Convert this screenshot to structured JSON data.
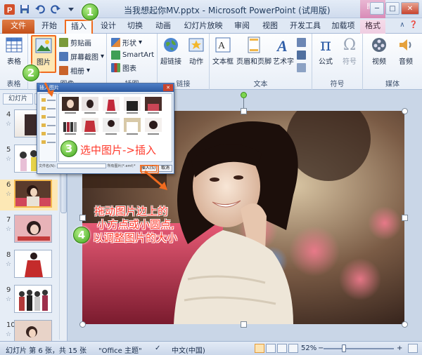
{
  "window": {
    "title": "当我想起你MV.pptx - Microsoft PowerPoint (试用版)",
    "context_tab_header": "图..."
  },
  "tabs": [
    {
      "label": "文件"
    },
    {
      "label": "开始"
    },
    {
      "label": "插入"
    },
    {
      "label": "设计"
    },
    {
      "label": "切换"
    },
    {
      "label": "动画"
    },
    {
      "label": "幻灯片放映"
    },
    {
      "label": "审阅"
    },
    {
      "label": "视图"
    },
    {
      "label": "开发工具"
    },
    {
      "label": "加载项"
    },
    {
      "label": "格式"
    }
  ],
  "ribbon": {
    "groups": {
      "tables": "表格",
      "images": "图像",
      "illustrations": "插图",
      "links": "链接",
      "text": "文本",
      "symbols": "符号",
      "media": "媒体"
    },
    "buttons": {
      "table": "表格",
      "picture": "图片",
      "clipart": "剪贴画",
      "screenshot": "屏幕截图",
      "album": "相册",
      "shapes": "形状",
      "smartart": "SmartArt",
      "chart": "图表",
      "hyperlink": "超链接",
      "action": "动作",
      "textbox": "文本框",
      "header_footer": "页眉和页脚",
      "wordart": "艺术字",
      "equation": "公式",
      "symbol": "符号",
      "video": "视频",
      "audio": "音频"
    }
  },
  "slides_pane": {
    "tabs": [
      "幻灯片",
      "大纲"
    ],
    "thumbs": [
      {
        "num": "4"
      },
      {
        "num": "5"
      },
      {
        "num": "6"
      },
      {
        "num": "7"
      },
      {
        "num": "8"
      },
      {
        "num": "9"
      },
      {
        "num": "10"
      }
    ]
  },
  "dialog": {
    "title": "插入图片",
    "insert_label": "插入(S)",
    "cancel_label": "取消",
    "filename_label": "文件名(N):",
    "filter": "所有图片(*.emf;*.wmf;*.jpg;*.jpeg...)"
  },
  "callouts": {
    "step1": "1",
    "step2": "2",
    "step3": "3",
    "step4": "4",
    "note3": "选中图片->插入",
    "note4_line1": "拖动图片边上的",
    "note4_line2": "小方点或小圆点,",
    "note4_line3": "以调整图片的大小"
  },
  "statusbar": {
    "slide_info": "幻灯片 第 6 张，共 15 张",
    "theme": "\"Office 主题\"",
    "language": "中文(中国)",
    "zoom": "52%",
    "zoom_value": 0.52
  },
  "colors": {
    "highlight": "#f06b1f",
    "callout_text": "#ff3a2c",
    "step_badge": "#3fa51b"
  }
}
